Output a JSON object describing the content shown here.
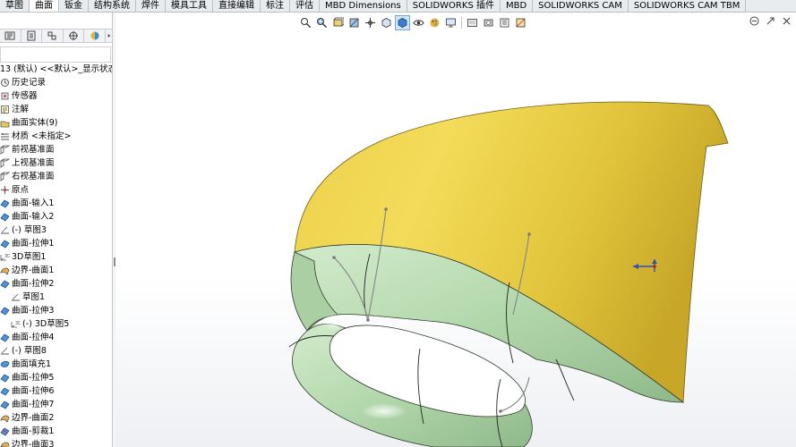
{
  "tabs": [
    {
      "label": "草图",
      "active": false
    },
    {
      "label": "曲面",
      "active": true
    },
    {
      "label": "钣金",
      "active": false
    },
    {
      "label": "结构系统",
      "active": false
    },
    {
      "label": "焊件",
      "active": false
    },
    {
      "label": "模具工具",
      "active": false
    },
    {
      "label": "直接编辑",
      "active": false
    },
    {
      "label": "标注",
      "active": false
    },
    {
      "label": "评估",
      "active": false
    },
    {
      "label": "MBD Dimensions",
      "active": false
    },
    {
      "label": "SOLIDWORKS 插件",
      "active": false
    },
    {
      "label": "MBD",
      "active": false
    },
    {
      "label": "SOLIDWORKS CAM",
      "active": false
    },
    {
      "label": "SOLIDWORKS CAM TBM",
      "active": false
    }
  ],
  "tree": {
    "root": "13 (默认) <<默认>_显示状态",
    "items": [
      {
        "label": "历史记录",
        "icon": "history-icon"
      },
      {
        "label": "传感器",
        "icon": "sensor-icon"
      },
      {
        "label": "注解",
        "icon": "annotation-icon"
      },
      {
        "label": "曲面实体(9)",
        "icon": "surface-bodies-icon"
      },
      {
        "label": "材质 <未指定>",
        "icon": "material-icon"
      },
      {
        "label": "前视基准面",
        "icon": "plane-icon"
      },
      {
        "label": "上视基准面",
        "icon": "plane-icon"
      },
      {
        "label": "右视基准面",
        "icon": "plane-icon"
      },
      {
        "label": "原点",
        "icon": "origin-icon"
      },
      {
        "label": "曲面-输入1",
        "icon": "surface-feature-icon"
      },
      {
        "label": "曲面-输入2",
        "icon": "surface-feature-icon"
      },
      {
        "label": "(-) 草图3",
        "icon": "sketch-icon"
      },
      {
        "label": "曲面-拉伸1",
        "icon": "surface-feature-icon"
      },
      {
        "label": "3D草图1",
        "icon": "sketch3d-icon"
      },
      {
        "label": "边界-曲面1",
        "icon": "boundary-surface-icon"
      },
      {
        "label": "曲面-拉伸2",
        "icon": "surface-feature-icon"
      },
      {
        "label": "草图1",
        "icon": "sketch-icon",
        "indent": true
      },
      {
        "label": "曲面-拉伸3",
        "icon": "surface-feature-icon"
      },
      {
        "label": "(-) 3D草图5",
        "icon": "sketch3d-icon",
        "indent": true
      },
      {
        "label": "曲面-拉伸4",
        "icon": "surface-feature-icon"
      },
      {
        "label": "(-) 草图8",
        "icon": "sketch-icon"
      },
      {
        "label": "曲面填充1",
        "icon": "fill-surface-icon"
      },
      {
        "label": "曲面-拉伸5",
        "icon": "surface-feature-icon"
      },
      {
        "label": "曲面-拉伸6",
        "icon": "surface-feature-icon"
      },
      {
        "label": "曲面-拉伸7",
        "icon": "surface-feature-icon"
      },
      {
        "label": "边界-曲面2",
        "icon": "boundary-surface-icon"
      },
      {
        "label": "曲面-剪裁1",
        "icon": "trim-surface-icon"
      },
      {
        "label": "边界-曲面3",
        "icon": "boundary-surface-icon"
      }
    ]
  },
  "colors": {
    "yellow_surface": "#e3c63a",
    "green_surface": "#b6dab0",
    "accent_blue": "#3a6fc4"
  }
}
